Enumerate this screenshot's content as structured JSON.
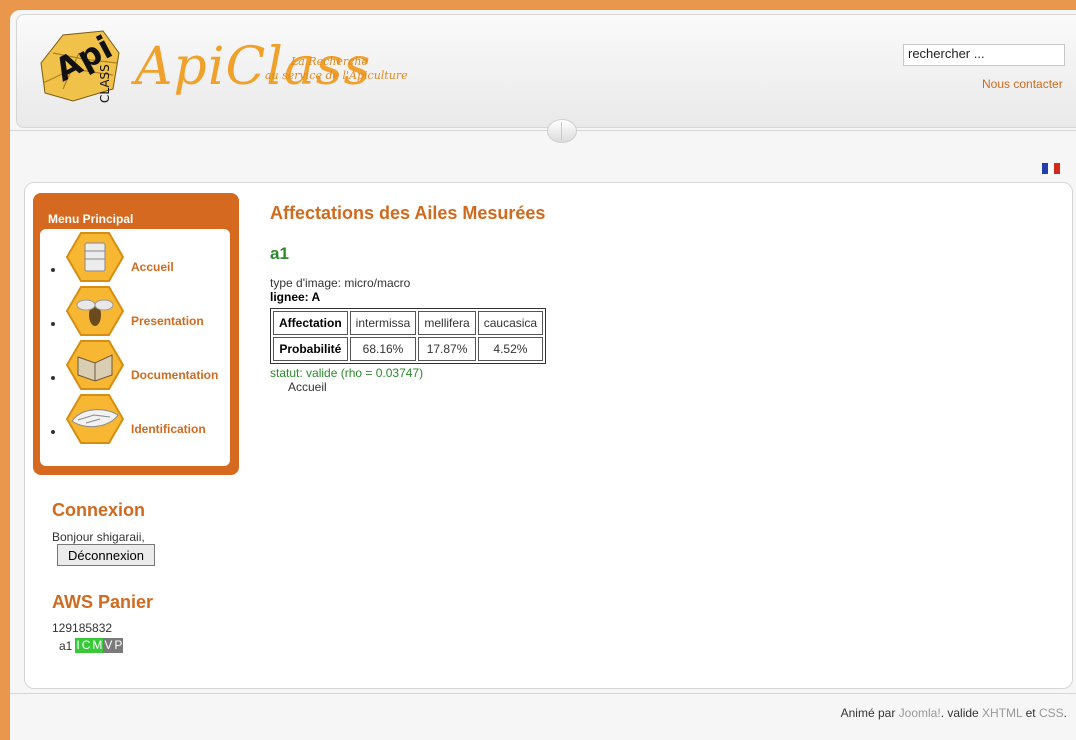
{
  "header": {
    "logo_badge_text": "Api",
    "logo_badge_sub": "CLASS",
    "logo_text": "ApiClass",
    "tagline_line1": "La Recherche",
    "tagline_line2": "au service de l'Apiculture",
    "search_value": "rechercher ...",
    "contact_label": "Nous contacter",
    "flag_colors": [
      "#1f3fae",
      "#ffffff",
      "#d52a1a"
    ]
  },
  "sidebar": {
    "menu_title": "Menu Principal",
    "items": [
      {
        "label": "Accueil",
        "icon": "beehive-icon"
      },
      {
        "label": "Presentation",
        "icon": "bee-icon"
      },
      {
        "label": "Documentation",
        "icon": "book-icon"
      },
      {
        "label": "Identification",
        "icon": "wing-icon"
      }
    ],
    "login_heading": "Connexion",
    "greeting": "Bonjour shigaraii,",
    "logout_label": "Déconnexion",
    "cart_heading": "AWS Panier",
    "cart_id": "129185832",
    "cart_item": "a1",
    "cart_tags": [
      {
        "label": "I",
        "color": "#39c83a"
      },
      {
        "label": "C",
        "color": "#39c83a"
      },
      {
        "label": "M",
        "color": "#39c83a"
      },
      {
        "label": "V",
        "color": "#7a7a7a"
      },
      {
        "label": "P",
        "color": "#7a7a7a"
      }
    ]
  },
  "content": {
    "title": "Affectations des Ailes Mesurées",
    "record": "a1",
    "image_type": "type d'image: micro/macro",
    "lineage": "lignee: A",
    "table": {
      "header_row": [
        "Affectation",
        "intermissa",
        "mellifera",
        "caucasica"
      ],
      "prob_row": [
        "Probabilité",
        "68.16%",
        "17.87%",
        "4.52%"
      ]
    },
    "status": "statut: valide (rho = 0.03747)",
    "home_link": "Accueil"
  },
  "footer": {
    "prefix": "Animé par ",
    "joomla": "Joomla!",
    "middle": ". valide ",
    "xhtml": "XHTML",
    "and": " et ",
    "css": "CSS",
    "end": "."
  },
  "colors": {
    "accent": "#d06a1f",
    "valid_green": "#2b8a2b",
    "background_orange": "#e8974d"
  }
}
